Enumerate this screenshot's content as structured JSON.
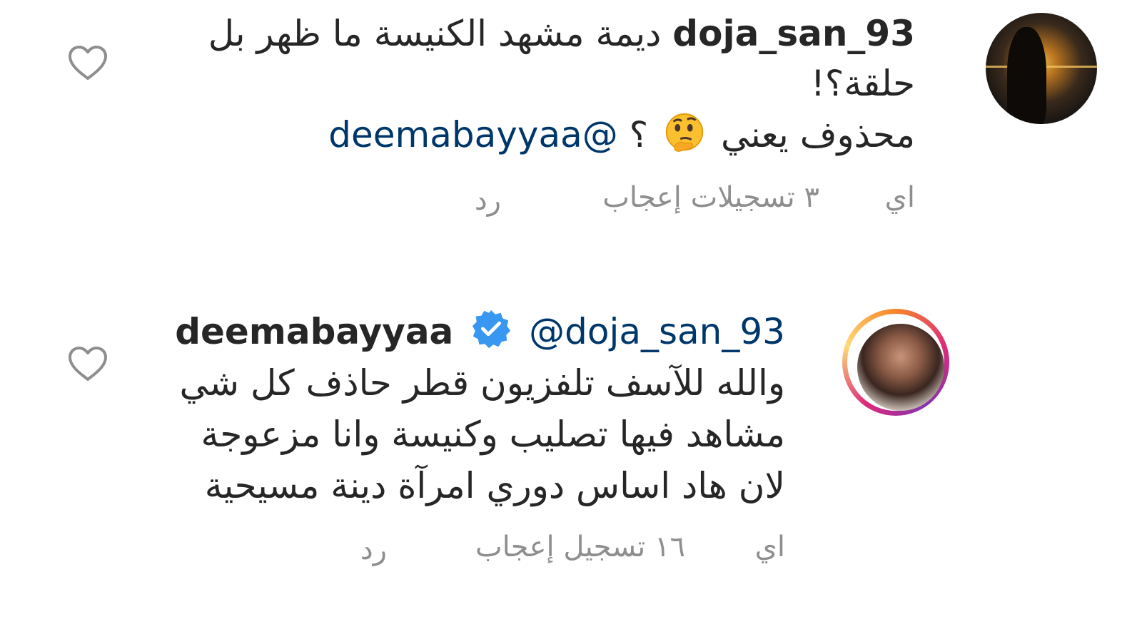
{
  "comments": [
    {
      "username": "doja_san_93",
      "line1": "ديمة مشهد الكنيسة ما ظهر بل",
      "line2": "حلقة؟!",
      "line3_text": "محذوف يعني",
      "line3_q": "؟",
      "mention": "@deemabayyaa",
      "emoji": "thinking-face-icon",
      "time": "اي",
      "likes": "٣ تسجيلات إعجاب",
      "reply": "رد"
    },
    {
      "username": "deemabayyaa",
      "verified": true,
      "mention": "@doja_san_93",
      "line1": "والله للآسف تلفزيون قطر حاذف كل شي",
      "line2": "مشاهد فيها تصليب وكنيسة وانا مزعوجة",
      "line3": "لان هاد اساس دوري امرآة دينة مسيحية",
      "time": "اي",
      "likes": "١٦ تسجيل إعجاب",
      "reply": "رد"
    }
  ],
  "colors": {
    "text": "#262626",
    "mention": "#00376b",
    "meta": "#8e8e8e",
    "verified": "#3897f0",
    "heart": "#8e8e8e"
  }
}
